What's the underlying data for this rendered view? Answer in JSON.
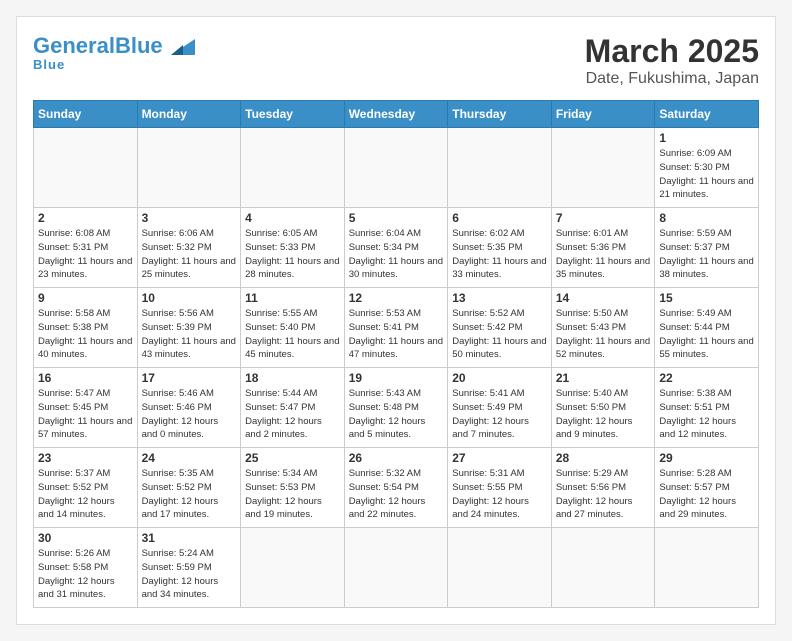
{
  "header": {
    "logo_general": "General",
    "logo_blue": "Blue",
    "title": "March 2025",
    "subtitle": "Date, Fukushima, Japan"
  },
  "days_of_week": [
    "Sunday",
    "Monday",
    "Tuesday",
    "Wednesday",
    "Thursday",
    "Friday",
    "Saturday"
  ],
  "weeks": [
    [
      {
        "day": "",
        "info": ""
      },
      {
        "day": "",
        "info": ""
      },
      {
        "day": "",
        "info": ""
      },
      {
        "day": "",
        "info": ""
      },
      {
        "day": "",
        "info": ""
      },
      {
        "day": "",
        "info": ""
      },
      {
        "day": "1",
        "info": "Sunrise: 6:09 AM\nSunset: 5:30 PM\nDaylight: 11 hours and 21 minutes."
      }
    ],
    [
      {
        "day": "2",
        "info": "Sunrise: 6:08 AM\nSunset: 5:31 PM\nDaylight: 11 hours and 23 minutes."
      },
      {
        "day": "3",
        "info": "Sunrise: 6:06 AM\nSunset: 5:32 PM\nDaylight: 11 hours and 25 minutes."
      },
      {
        "day": "4",
        "info": "Sunrise: 6:05 AM\nSunset: 5:33 PM\nDaylight: 11 hours and 28 minutes."
      },
      {
        "day": "5",
        "info": "Sunrise: 6:04 AM\nSunset: 5:34 PM\nDaylight: 11 hours and 30 minutes."
      },
      {
        "day": "6",
        "info": "Sunrise: 6:02 AM\nSunset: 5:35 PM\nDaylight: 11 hours and 33 minutes."
      },
      {
        "day": "7",
        "info": "Sunrise: 6:01 AM\nSunset: 5:36 PM\nDaylight: 11 hours and 35 minutes."
      },
      {
        "day": "8",
        "info": "Sunrise: 5:59 AM\nSunset: 5:37 PM\nDaylight: 11 hours and 38 minutes."
      }
    ],
    [
      {
        "day": "9",
        "info": "Sunrise: 5:58 AM\nSunset: 5:38 PM\nDaylight: 11 hours and 40 minutes."
      },
      {
        "day": "10",
        "info": "Sunrise: 5:56 AM\nSunset: 5:39 PM\nDaylight: 11 hours and 43 minutes."
      },
      {
        "day": "11",
        "info": "Sunrise: 5:55 AM\nSunset: 5:40 PM\nDaylight: 11 hours and 45 minutes."
      },
      {
        "day": "12",
        "info": "Sunrise: 5:53 AM\nSunset: 5:41 PM\nDaylight: 11 hours and 47 minutes."
      },
      {
        "day": "13",
        "info": "Sunrise: 5:52 AM\nSunset: 5:42 PM\nDaylight: 11 hours and 50 minutes."
      },
      {
        "day": "14",
        "info": "Sunrise: 5:50 AM\nSunset: 5:43 PM\nDaylight: 11 hours and 52 minutes."
      },
      {
        "day": "15",
        "info": "Sunrise: 5:49 AM\nSunset: 5:44 PM\nDaylight: 11 hours and 55 minutes."
      }
    ],
    [
      {
        "day": "16",
        "info": "Sunrise: 5:47 AM\nSunset: 5:45 PM\nDaylight: 11 hours and 57 minutes."
      },
      {
        "day": "17",
        "info": "Sunrise: 5:46 AM\nSunset: 5:46 PM\nDaylight: 12 hours and 0 minutes."
      },
      {
        "day": "18",
        "info": "Sunrise: 5:44 AM\nSunset: 5:47 PM\nDaylight: 12 hours and 2 minutes."
      },
      {
        "day": "19",
        "info": "Sunrise: 5:43 AM\nSunset: 5:48 PM\nDaylight: 12 hours and 5 minutes."
      },
      {
        "day": "20",
        "info": "Sunrise: 5:41 AM\nSunset: 5:49 PM\nDaylight: 12 hours and 7 minutes."
      },
      {
        "day": "21",
        "info": "Sunrise: 5:40 AM\nSunset: 5:50 PM\nDaylight: 12 hours and 9 minutes."
      },
      {
        "day": "22",
        "info": "Sunrise: 5:38 AM\nSunset: 5:51 PM\nDaylight: 12 hours and 12 minutes."
      }
    ],
    [
      {
        "day": "23",
        "info": "Sunrise: 5:37 AM\nSunset: 5:52 PM\nDaylight: 12 hours and 14 minutes."
      },
      {
        "day": "24",
        "info": "Sunrise: 5:35 AM\nSunset: 5:52 PM\nDaylight: 12 hours and 17 minutes."
      },
      {
        "day": "25",
        "info": "Sunrise: 5:34 AM\nSunset: 5:53 PM\nDaylight: 12 hours and 19 minutes."
      },
      {
        "day": "26",
        "info": "Sunrise: 5:32 AM\nSunset: 5:54 PM\nDaylight: 12 hours and 22 minutes."
      },
      {
        "day": "27",
        "info": "Sunrise: 5:31 AM\nSunset: 5:55 PM\nDaylight: 12 hours and 24 minutes."
      },
      {
        "day": "28",
        "info": "Sunrise: 5:29 AM\nSunset: 5:56 PM\nDaylight: 12 hours and 27 minutes."
      },
      {
        "day": "29",
        "info": "Sunrise: 5:28 AM\nSunset: 5:57 PM\nDaylight: 12 hours and 29 minutes."
      }
    ],
    [
      {
        "day": "30",
        "info": "Sunrise: 5:26 AM\nSunset: 5:58 PM\nDaylight: 12 hours and 31 minutes."
      },
      {
        "day": "31",
        "info": "Sunrise: 5:24 AM\nSunset: 5:59 PM\nDaylight: 12 hours and 34 minutes."
      },
      {
        "day": "",
        "info": ""
      },
      {
        "day": "",
        "info": ""
      },
      {
        "day": "",
        "info": ""
      },
      {
        "day": "",
        "info": ""
      },
      {
        "day": "",
        "info": ""
      }
    ]
  ]
}
